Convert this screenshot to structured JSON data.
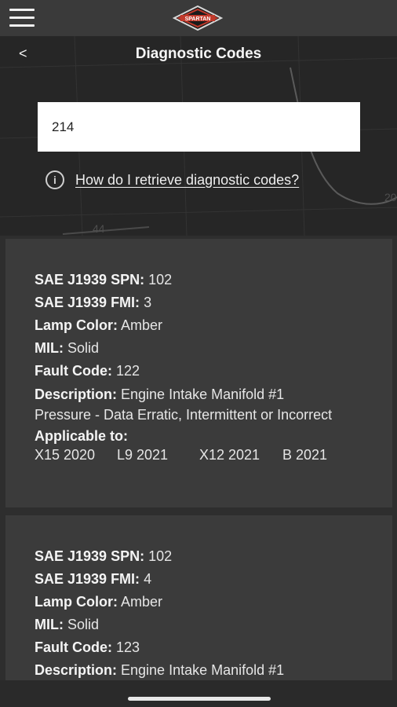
{
  "header": {
    "logo_text": "SPARTAN"
  },
  "nav": {
    "back_label": "<",
    "title": "Diagnostic Codes"
  },
  "search": {
    "value": "214",
    "help_icon": "i",
    "help_link": "How do I retrieve diagnostic codes?"
  },
  "background_numbers": [
    "44",
    "20"
  ],
  "results": [
    {
      "spn_label": "SAE J1939 SPN:",
      "spn": " 102",
      "fmi_label": "SAE J1939 FMI:",
      "fmi": " 3",
      "lamp_label": "Lamp Color:",
      "lamp": " Amber",
      "mil_label": "MIL:",
      "mil": " Solid",
      "fault_label": "Fault Code:",
      "fault": " 122",
      "desc_label": "Description:",
      "desc": " Engine Intake Manifold #1 Pressure - Data Erratic, Intermittent or Incorrect",
      "applicable_label": "Applicable to:",
      "models": [
        "X15 2020",
        "L9 2021",
        "X12 2021",
        "B 2021"
      ]
    },
    {
      "spn_label": "SAE J1939 SPN:",
      "spn": " 102",
      "fmi_label": "SAE J1939 FMI:",
      "fmi": " 4",
      "lamp_label": "Lamp Color:",
      "lamp": " Amber",
      "mil_label": "MIL:",
      "mil": " Solid",
      "fault_label": "Fault Code:",
      "fault": " 123",
      "desc_label": "Description:",
      "desc": " Engine Intake Manifold #1"
    }
  ],
  "icons": {
    "menu": "hamburger-menu-icon",
    "logo": "spartan-logo-icon",
    "info": "info-circle-icon"
  }
}
